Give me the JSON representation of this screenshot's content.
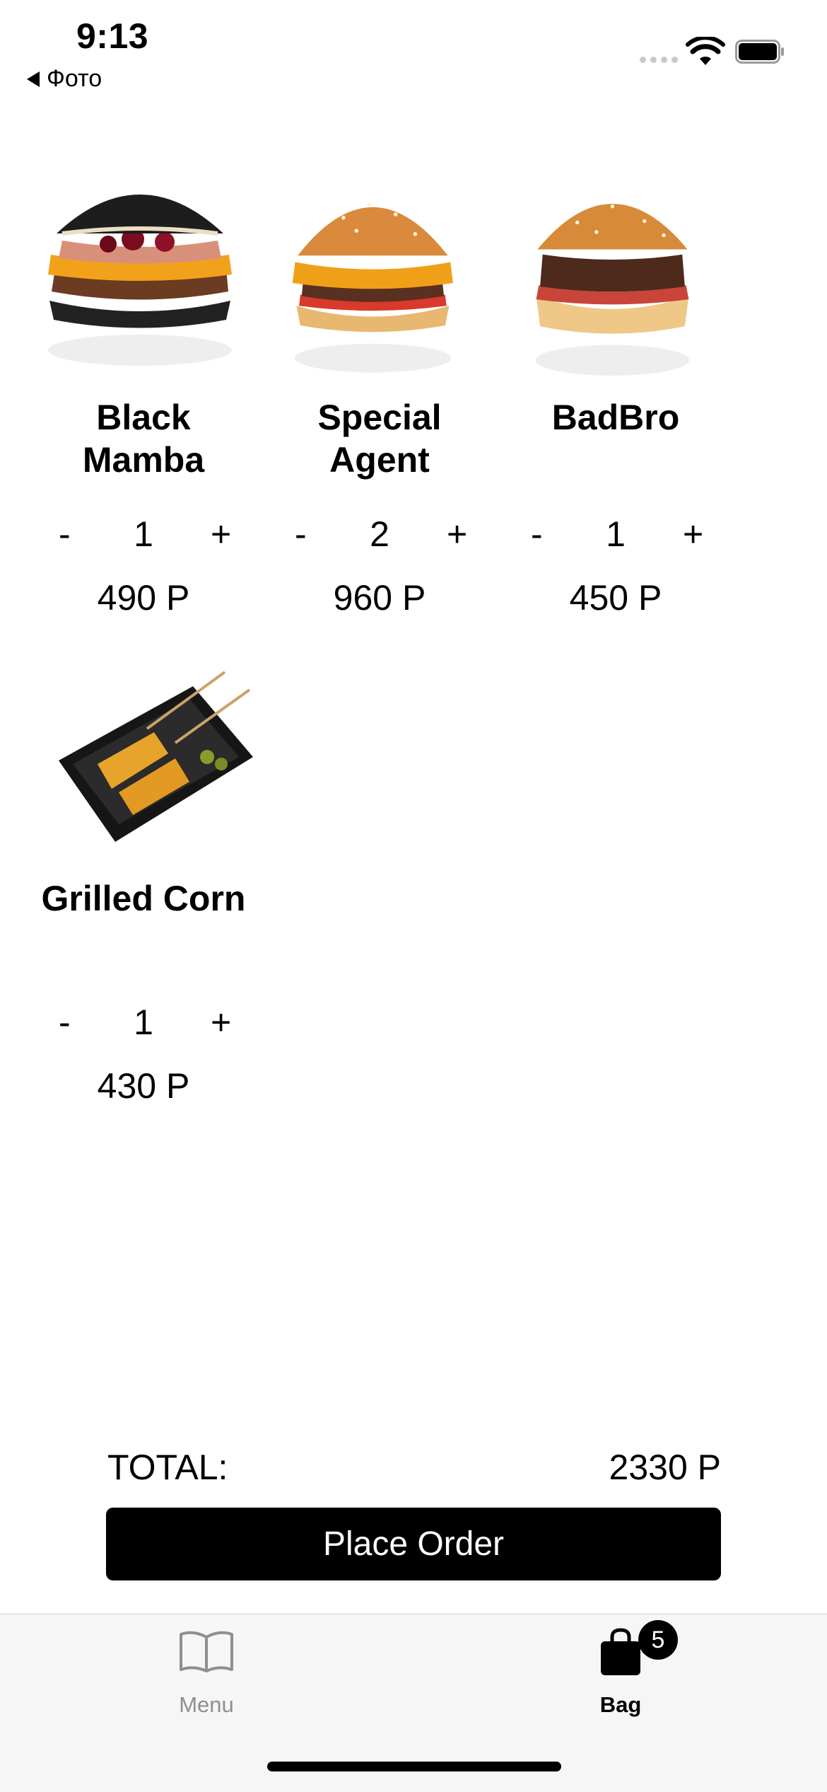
{
  "status_bar": {
    "time": "9:13",
    "back_label": "Фото"
  },
  "products": [
    {
      "name_line1": "Black",
      "name_line2": "Mamba",
      "minus": "-",
      "quantity": "1",
      "plus": "+",
      "price": "490 Р"
    },
    {
      "name_line1": "Special",
      "name_line2": "Agent",
      "minus": "-",
      "quantity": "2",
      "plus": "+",
      "price": "960 Р"
    },
    {
      "name_line1": "BadBro",
      "name_line2": "",
      "minus": "-",
      "quantity": "1",
      "plus": "+",
      "price": "450 Р"
    },
    {
      "name_line1": "Grilled Corn",
      "name_line2": "",
      "minus": "-",
      "quantity": "1",
      "plus": "+",
      "price": "430 Р"
    }
  ],
  "order": {
    "total_label": "TOTAL:",
    "total_value": "2330 Р",
    "button_label": "Place Order"
  },
  "tabbar": {
    "menu_label": "Menu",
    "bag_label": "Bag",
    "bag_badge": "5",
    "menu_icon": "book-icon",
    "bag_icon": "shopping-bag-icon"
  },
  "colors": {
    "accent": "#000000",
    "inactive_tab": "#8e8e93",
    "tabbar_bg": "#f6f6f6"
  }
}
